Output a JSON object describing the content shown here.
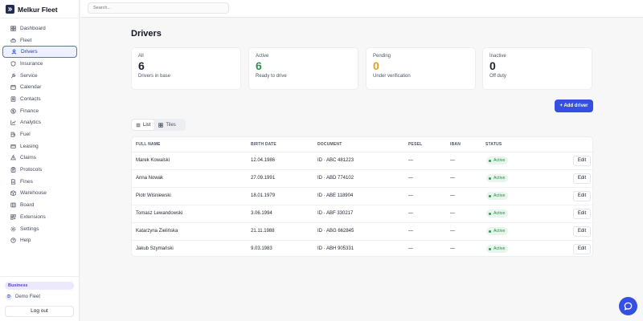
{
  "app": {
    "name": "Melkur Fleet"
  },
  "search": {
    "placeholder": "Search..."
  },
  "sidebar": {
    "items": [
      {
        "label": "Dashboard",
        "icon": "dashboard-icon"
      },
      {
        "label": "Fleet",
        "icon": "car-icon"
      },
      {
        "label": "Drivers",
        "icon": "user-icon",
        "active": true
      },
      {
        "label": "Insurance",
        "icon": "shield-icon"
      },
      {
        "label": "Service",
        "icon": "wrench-icon"
      },
      {
        "label": "Calendar",
        "icon": "calendar-icon"
      },
      {
        "label": "Contacts",
        "icon": "contacts-icon"
      },
      {
        "label": "Finance",
        "icon": "dollar-icon"
      },
      {
        "label": "Analytics",
        "icon": "chart-icon"
      },
      {
        "label": "Fuel",
        "icon": "fuel-icon"
      },
      {
        "label": "Leasing",
        "icon": "card-icon"
      },
      {
        "label": "Claims",
        "icon": "warning-icon"
      },
      {
        "label": "Protocols",
        "icon": "clipboard-icon"
      },
      {
        "label": "Fines",
        "icon": "document-icon"
      },
      {
        "label": "Warehouse",
        "icon": "box-icon"
      },
      {
        "label": "Board",
        "icon": "board-icon"
      },
      {
        "label": "Extensions",
        "icon": "puzzle-icon"
      },
      {
        "label": "Settings",
        "icon": "gear-icon"
      },
      {
        "label": "Help",
        "icon": "help-icon"
      }
    ],
    "plan": "Business",
    "fleet_initial": "D",
    "fleet_name": "Demo Fleet",
    "logout": "Log out"
  },
  "page": {
    "title": "Drivers"
  },
  "stats": [
    {
      "label": "All",
      "value": "6",
      "sub": "Drivers in base",
      "color": "#1f2330"
    },
    {
      "label": "Active",
      "value": "6",
      "sub": "Ready to drive",
      "color": "#2f8f4e"
    },
    {
      "label": "Pending",
      "value": "0",
      "sub": "Under verification",
      "color": "#e0a21b"
    },
    {
      "label": "Inactive",
      "value": "0",
      "sub": "Off duty",
      "color": "#1f2330"
    }
  ],
  "actions": {
    "add_driver": "+ Add driver"
  },
  "view": {
    "list": "List",
    "tiles": "Tiles"
  },
  "table": {
    "headers": {
      "name": "FULL NAME",
      "birth": "BIRTH DATE",
      "document": "DOCUMENT",
      "pesel": "PESEL",
      "iban": "IBAN",
      "status": "STATUS"
    },
    "edit_label": "Edit",
    "rows": [
      {
        "name": "Marek Kowalski",
        "birth": "12.04.1986",
        "document": "ID · ABC 481223",
        "pesel": "—",
        "iban": "—",
        "status": "Active"
      },
      {
        "name": "Anna Nowak",
        "birth": "27.09.1991",
        "document": "ID · ABD 774102",
        "pesel": "—",
        "iban": "—",
        "status": "Active"
      },
      {
        "name": "Piotr Wiśniewski",
        "birth": "18.01.1979",
        "document": "ID · ABE 118904",
        "pesel": "—",
        "iban": "—",
        "status": "Active"
      },
      {
        "name": "Tomasz Lewandowski",
        "birth": "3.06.1994",
        "document": "ID · ABF 330217",
        "pesel": "—",
        "iban": "—",
        "status": "Active"
      },
      {
        "name": "Katarzyna Zielińska",
        "birth": "21.11.1988",
        "document": "ID · ABG 662845",
        "pesel": "—",
        "iban": "—",
        "status": "Active"
      },
      {
        "name": "Jakub Szymański",
        "birth": "9.03.1983",
        "document": "ID · ABH 905331",
        "pesel": "—",
        "iban": "—",
        "status": "Active"
      }
    ]
  },
  "accent": "#3550e0"
}
